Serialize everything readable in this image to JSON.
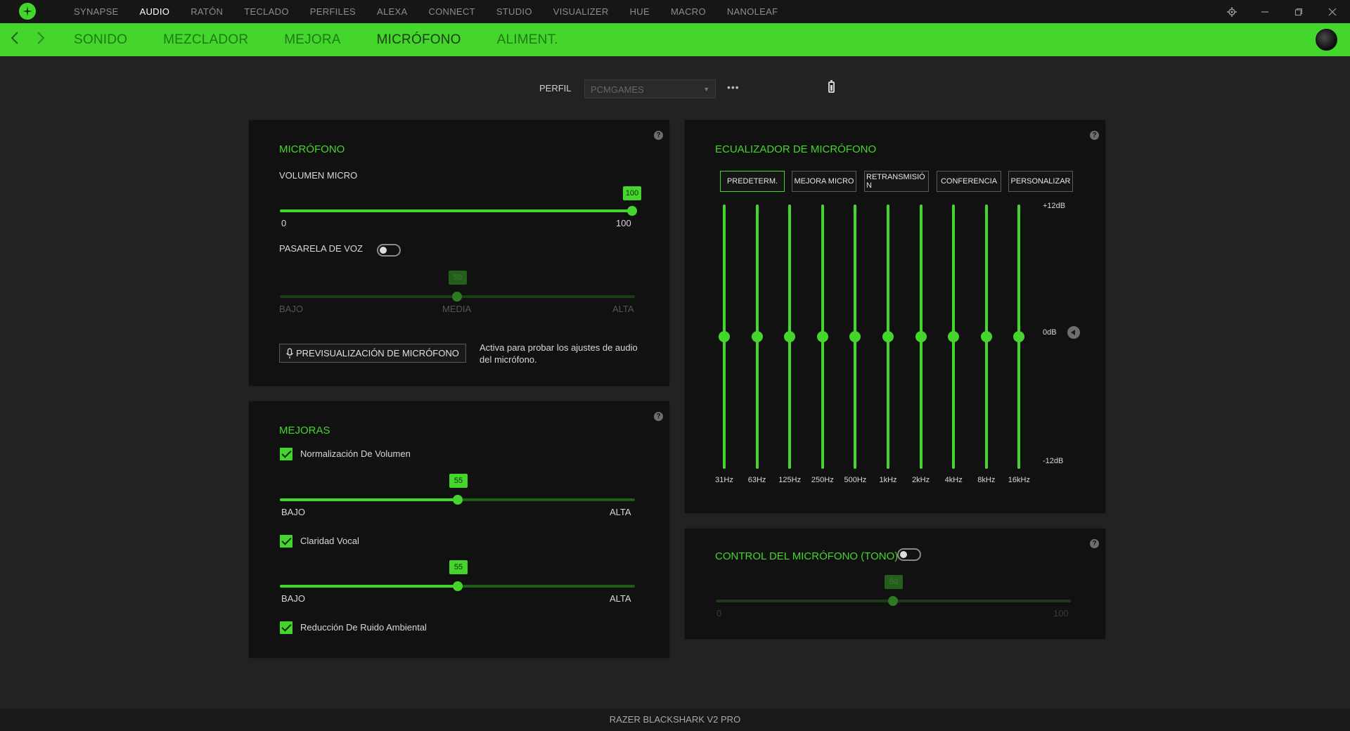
{
  "topnav": {
    "items": [
      "SYNAPSE",
      "AUDIO",
      "RATÓN",
      "TECLADO",
      "PERFILES",
      "ALEXA",
      "CONNECT",
      "STUDIO",
      "VISUALIZER",
      "HUE",
      "MACRO",
      "NANOLEAF"
    ],
    "active": "AUDIO"
  },
  "subnav": {
    "items": [
      "SONIDO",
      "MEZCLADOR",
      "MEJORA",
      "MICRÓFONO",
      "ALIMENT."
    ],
    "active": "MICRÓFONO"
  },
  "profile": {
    "label": "PERFIL",
    "value": "PCMGAMES",
    "more": "•••"
  },
  "microphone_panel": {
    "title": "MICRÓFONO",
    "volume_label": "VOLUMEN MICRO",
    "volume_value": "100",
    "volume_min": "0",
    "volume_max": "100",
    "voice_gate_label": "PASARELA DE VOZ",
    "voice_gate_on": false,
    "voice_gate_value": "50",
    "low_label": "BAJO",
    "mid_label": "MEDIA",
    "high_label": "ALTA",
    "preview_button": "PREVISUALIZACIÓN DE MICRÓFONO",
    "preview_desc": "Activa para probar los ajustes de audio del micrófono."
  },
  "enhancements_panel": {
    "title": "MEJORAS",
    "volume_normalization_label": "Normalización De Volumen",
    "volume_normalization_value": "55",
    "vocal_clarity_label": "Claridad Vocal",
    "vocal_clarity_value": "55",
    "noise_reduction_label": "Reducción De Ruido Ambiental",
    "low_label": "BAJO",
    "high_label": "ALTA"
  },
  "eq_panel": {
    "title": "ECUALIZADOR DE MICRÓFONO",
    "presets": [
      "PREDETERM.",
      "MEJORA MICRO",
      "RETRANSMISIÓ N",
      "CONFERENCIA",
      "PERSONALIZAR"
    ],
    "active_preset": "PREDETERM.",
    "bands": [
      "31Hz",
      "63Hz",
      "125Hz",
      "250Hz",
      "500Hz",
      "1kHz",
      "2kHz",
      "4kHz",
      "8kHz",
      "16kHz"
    ],
    "band_gains_db": [
      0,
      0,
      0,
      0,
      0,
      0,
      0,
      0,
      0,
      0
    ],
    "db_top": "+12dB",
    "db_mid": "0dB",
    "db_bottom": "-12dB"
  },
  "mic_control_panel": {
    "title": "CONTROL DEL MICRÓFONO (TONO)",
    "enabled": false,
    "value": "50",
    "min": "0",
    "max": "100"
  },
  "footer": {
    "device": "RAZER BLACKSHARK V2 PRO"
  },
  "colors": {
    "accent": "#44d62c",
    "background": "#222222",
    "panel": "#111111"
  },
  "icons": [
    "razer-logo-icon",
    "settings-icon",
    "minimize-icon",
    "maximize-icon",
    "close-icon",
    "back-arrow-icon",
    "forward-arrow-icon",
    "battery-icon",
    "help-icon",
    "microphone-icon",
    "reset-icon"
  ]
}
